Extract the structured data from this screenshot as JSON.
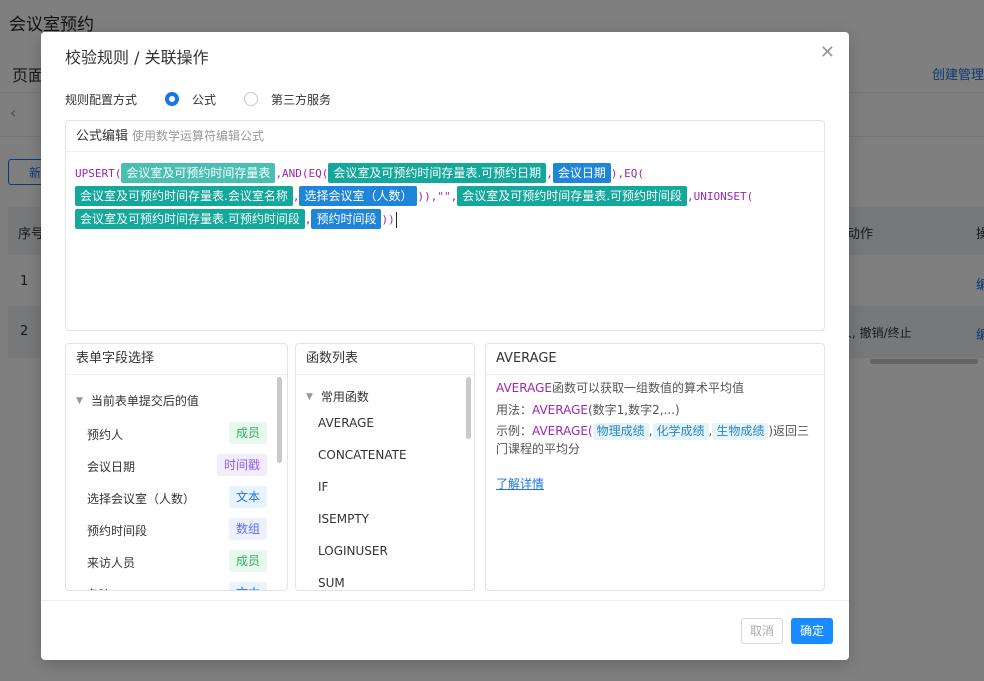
{
  "background": {
    "title": "会议室预约",
    "page_label": "页面",
    "create_link": "创建管理",
    "back_icon": "chevron-left-icon",
    "new_button": "新",
    "table": {
      "col_index": "序号",
      "col_action": "流动作",
      "col_op": "操",
      "rows": [
        {
          "index": "1",
          "action": "",
          "op": "编"
        },
        {
          "index": "2",
          "action": "人, 撤销/终止",
          "op": "编"
        }
      ]
    }
  },
  "dialog": {
    "title": "校验规则 / 关联操作",
    "close_icon": "close-icon",
    "config_label": "规则配置方式",
    "options": [
      {
        "label": "公式",
        "checked": true
      },
      {
        "label": "第三方服务",
        "checked": false
      }
    ],
    "editor": {
      "title": "公式编辑",
      "hint": "使用数学运算符编辑公式",
      "tokens": [
        {
          "t": "text",
          "v": "UPSERT("
        },
        {
          "t": "chip",
          "c": "light",
          "v": "会议室及可预约时间存量表"
        },
        {
          "t": "text",
          "v": ",AND(EQ("
        },
        {
          "t": "chip",
          "c": "teal",
          "v": "会议室及可预约时间存量表.可预约日期"
        },
        {
          "t": "text",
          "v": ","
        },
        {
          "t": "chip",
          "c": "blue",
          "v": "会议日期"
        },
        {
          "t": "text",
          "v": "),EQ("
        },
        {
          "t": "chip",
          "c": "teal",
          "v": "会议室及可预约时间存量表.会议室名称"
        },
        {
          "t": "text",
          "v": ","
        },
        {
          "t": "chip",
          "c": "blue",
          "v": "选择会议室（人数）"
        },
        {
          "t": "text",
          "v": ")),\"\","
        },
        {
          "t": "chip",
          "c": "teal",
          "v": "会议室及可预约时间存量表.可预约时间段"
        },
        {
          "t": "text",
          "v": ",UNIONSET("
        },
        {
          "t": "chip",
          "c": "teal",
          "v": "会议室及可预约时间存量表.可预约时间段"
        },
        {
          "t": "text",
          "v": ","
        },
        {
          "t": "chip",
          "c": "blue",
          "v": "预约时间段"
        },
        {
          "t": "text",
          "v": "))"
        }
      ]
    },
    "fields_panel": {
      "title": "表单字段选择",
      "group": "当前表单提交后的值",
      "fields": [
        {
          "name": "预约人",
          "type": "成员",
          "color": "green"
        },
        {
          "name": "会议日期",
          "type": "时间戳",
          "color": "purple"
        },
        {
          "name": "选择会议室（人数）",
          "type": "文本",
          "color": "blue"
        },
        {
          "name": "预约时间段",
          "type": "数组",
          "color": "indigo"
        },
        {
          "name": "来访人员",
          "type": "成员",
          "color": "green"
        },
        {
          "name": "备注",
          "type": "文本",
          "color": "blue"
        }
      ]
    },
    "functions_panel": {
      "title": "函数列表",
      "group": "常用函数",
      "functions": [
        "AVERAGE",
        "CONCATENATE",
        "IF",
        "ISEMPTY",
        "LOGINUSER",
        "SUM"
      ]
    },
    "desc_panel": {
      "title": "AVERAGE",
      "fn": "AVERAGE",
      "summary": "函数可以获取一组数值的算术平均值",
      "usage_label": "用法：",
      "usage_fn": "AVERAGE",
      "usage_args": "(数字1,数字2,...)",
      "example_label": "示例：",
      "example_fn": "AVERAGE(",
      "example_args": [
        "物理成绩",
        "化学成绩",
        "生物成绩"
      ],
      "example_tail": ")返回三门课程的平均分",
      "link": "了解详情"
    },
    "buttons": {
      "cancel": "取消",
      "ok": "确定"
    }
  }
}
